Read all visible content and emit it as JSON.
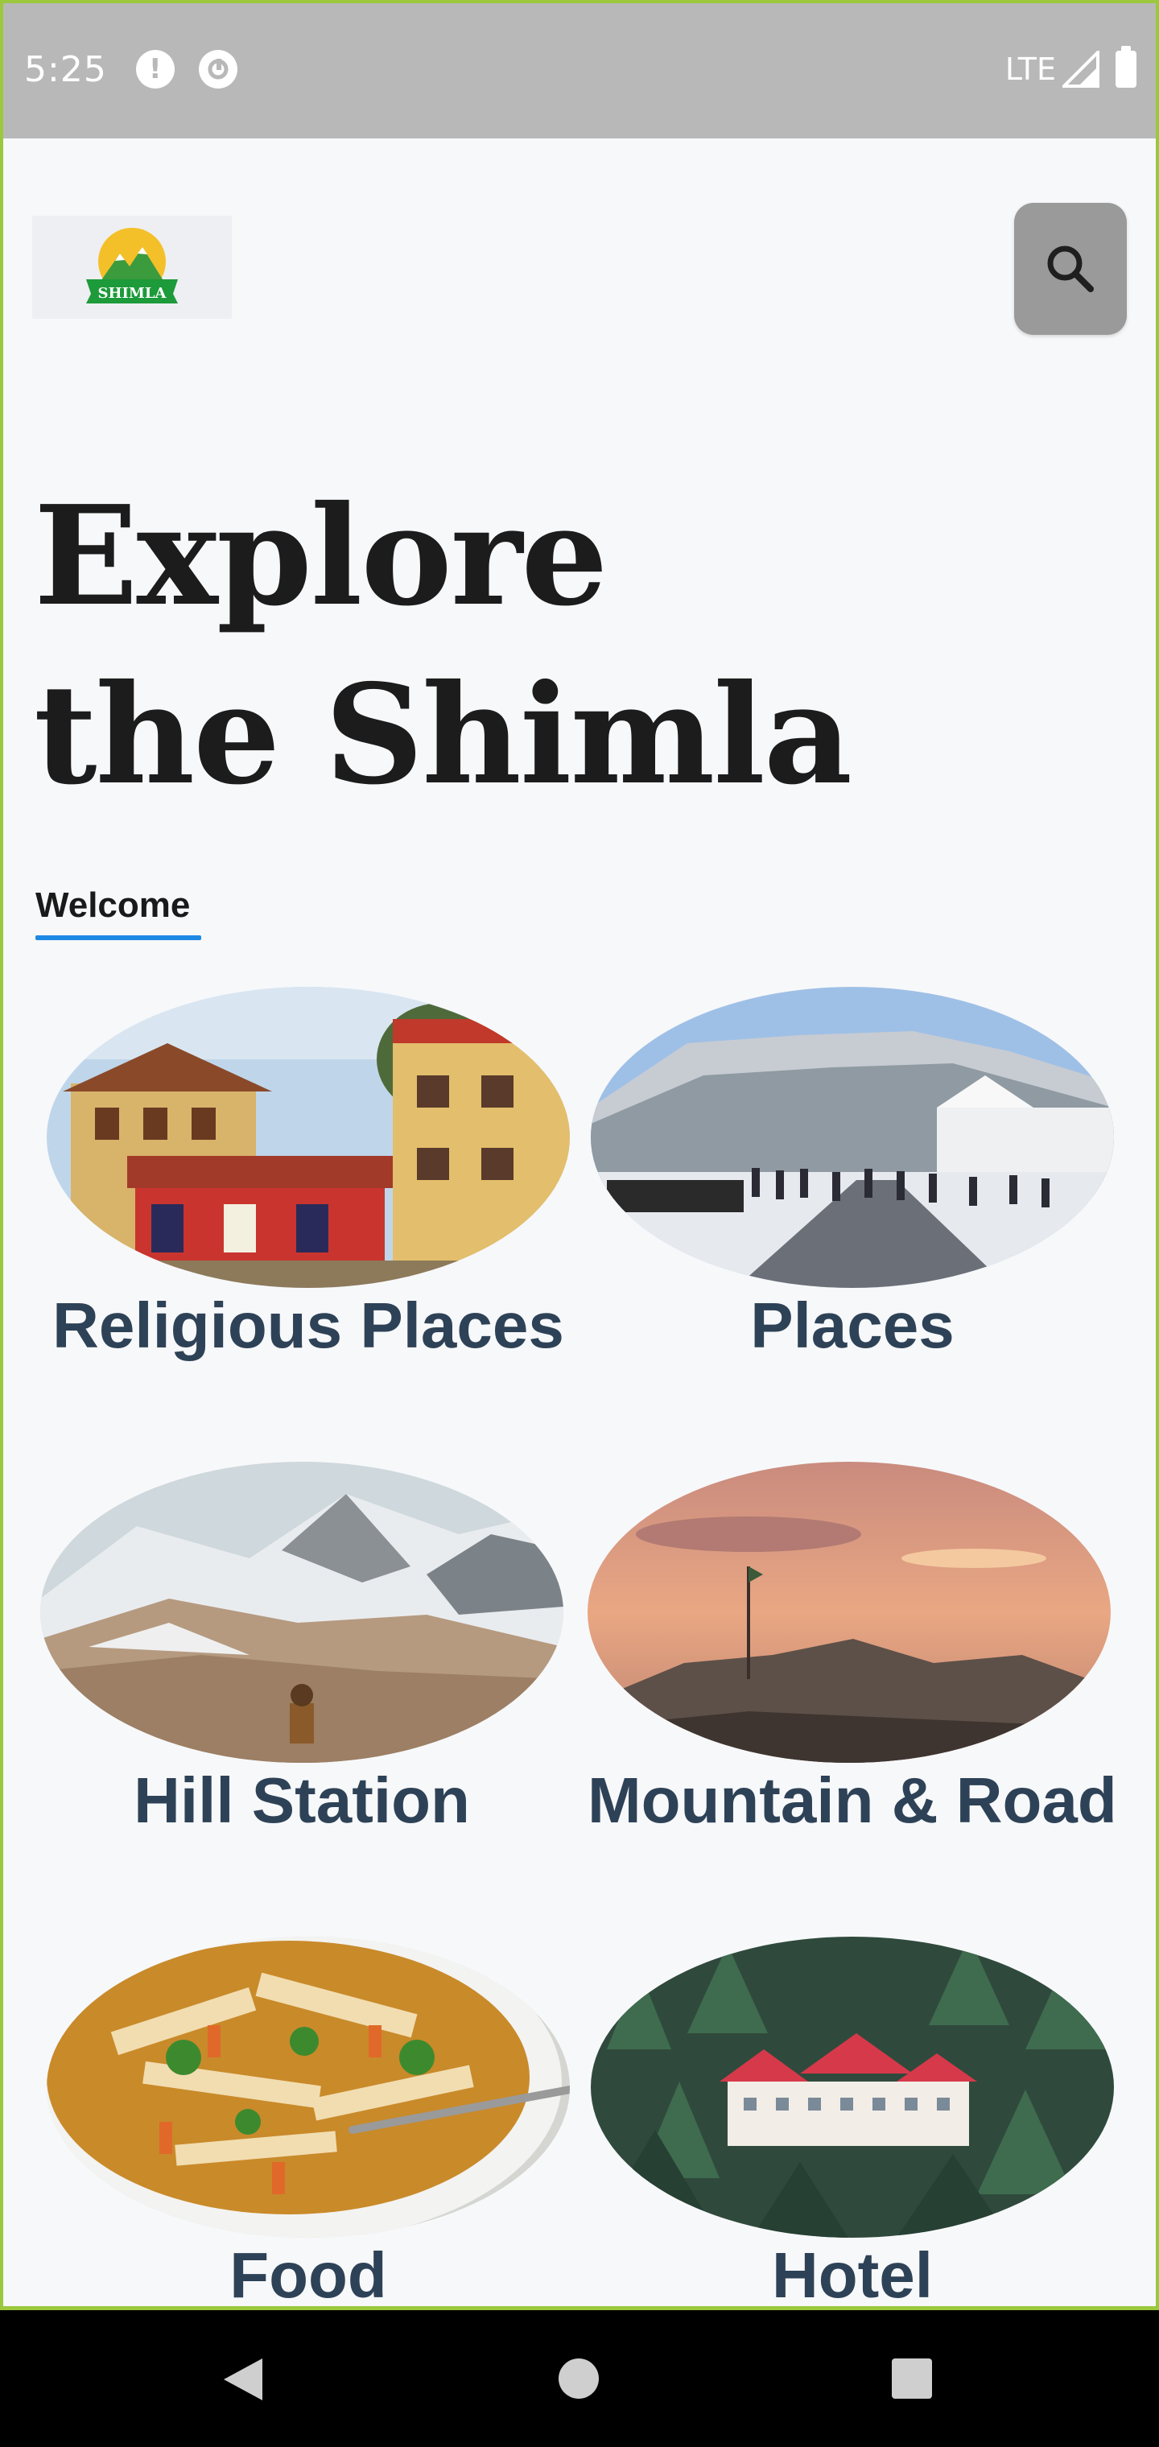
{
  "status_bar": {
    "time": "5:25",
    "network": "LTE",
    "icons": [
      "alert-icon",
      "sync-icon",
      "signal-icon",
      "battery-icon"
    ]
  },
  "header": {
    "logo_text": "SHIMLA",
    "search_icon": "search-icon"
  },
  "headline": {
    "line1": "Explore",
    "line2": "the Shimla"
  },
  "welcome_tab": "Welcome",
  "categories": [
    {
      "label": "Religious Places"
    },
    {
      "label": "Places"
    },
    {
      "label": "Hill Station"
    },
    {
      "label": "Mountain & Road"
    },
    {
      "label": "Food"
    },
    {
      "label": "Hotel"
    }
  ],
  "colors": {
    "status_bar": "#b8b8b8",
    "background": "#f7f8fa",
    "label_text": "#2e4257",
    "accent_underline": "#1e88e5",
    "frame": "#9bc83c"
  },
  "nav": {
    "icons": [
      "back-icon",
      "home-icon",
      "recents-icon"
    ]
  }
}
